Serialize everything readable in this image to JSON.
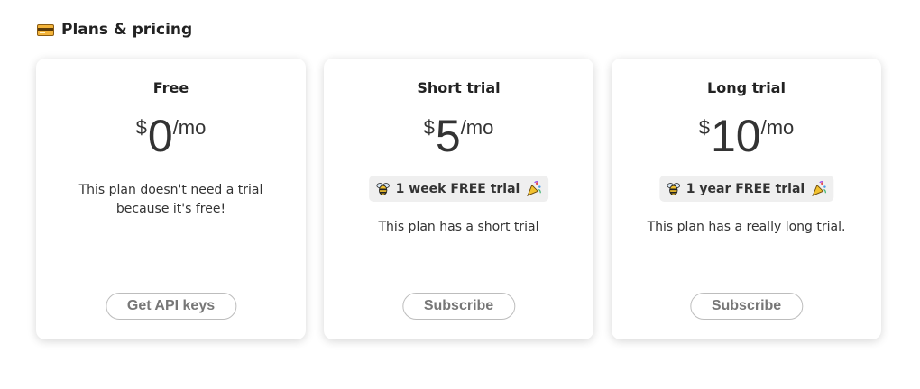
{
  "header": {
    "icon": "credit-card-icon",
    "title": "Plans & pricing"
  },
  "plans": [
    {
      "name": "Free",
      "currency": "$",
      "amount": "0",
      "period": "/mo",
      "trial": "",
      "description": "This plan doesn't need a trial because it's free!",
      "button": "Get API keys"
    },
    {
      "name": "Short trial",
      "currency": "$",
      "amount": "5",
      "period": "/mo",
      "trial": "1 week FREE trial",
      "description": "This plan has a short trial",
      "button": "Subscribe"
    },
    {
      "name": "Long trial",
      "currency": "$",
      "amount": "10",
      "period": "/mo",
      "trial": "1 year FREE trial",
      "description": "This plan has a really long trial.",
      "button": "Subscribe"
    }
  ],
  "icons": {
    "trial_left": "bee-icon",
    "trial_right": "party-popper-icon"
  },
  "colors": {
    "badge_bg": "#efefef",
    "button_text": "#777777",
    "card_accent": "#f3b43a"
  }
}
